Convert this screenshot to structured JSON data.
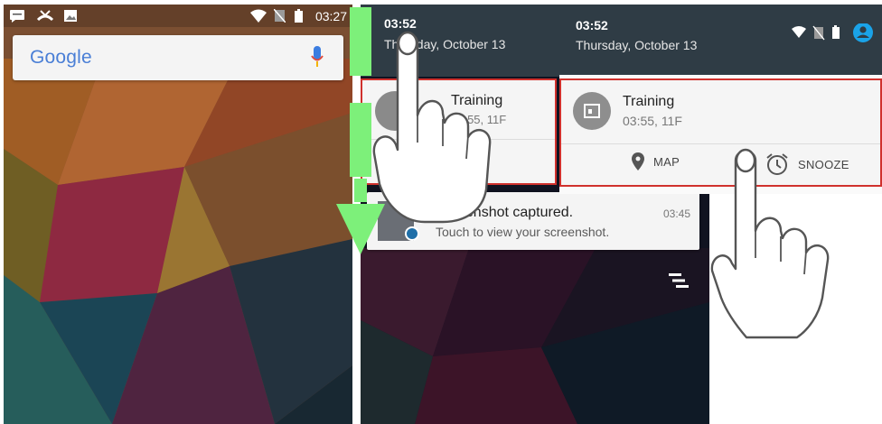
{
  "left_screen": {
    "status_time": "03:27",
    "google_logo": "Google",
    "status_icons": [
      "message-icon",
      "missed-call-icon",
      "image-icon",
      "wifi-icon",
      "no-sim-icon",
      "battery-icon"
    ]
  },
  "middle_screen": {
    "time": "03:52",
    "date": "Thursday, October 13",
    "event_title": "Training",
    "event_sub": "03:55, 11F",
    "screenshot_title": "Screenshot captured.",
    "screenshot_time": "03:45",
    "screenshot_sub": "Touch to view your screenshot."
  },
  "right_screen": {
    "time": "03:52",
    "date": "Thursday, October 13",
    "event_title": "Training",
    "event_sub": "03:55, 11F",
    "action_map": "MAP",
    "action_snooze": "SNOOZE"
  },
  "colors": {
    "shade": "#2f3c45",
    "highlight_border": "#d0312d",
    "swipe_arrow": "#7df07a",
    "account_icon": "#1aa3e8"
  }
}
